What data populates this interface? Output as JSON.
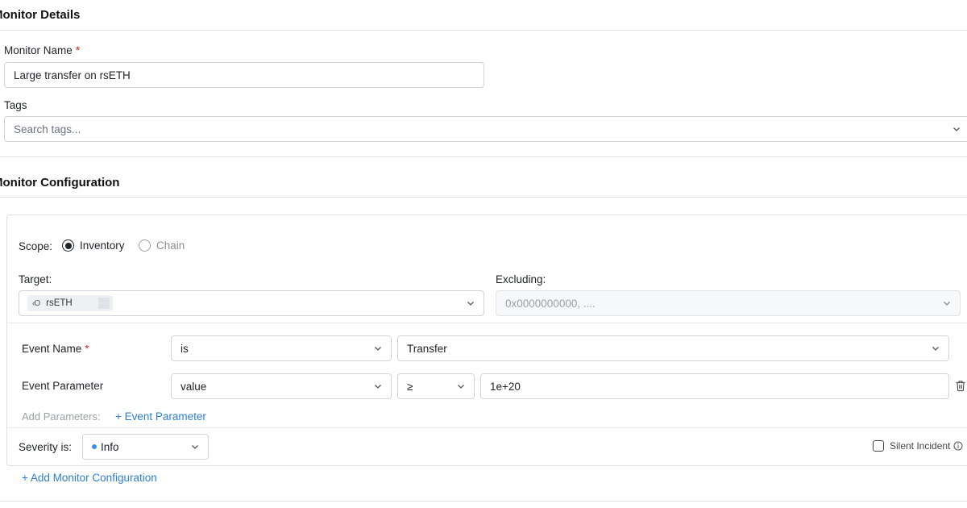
{
  "monitor_details": {
    "title": "Monitor Details",
    "name_label": "Monitor Name",
    "required_mark": "*",
    "name_value": "Large transfer on rsETH",
    "tags_label": "Tags",
    "tags_placeholder": "Search tags..."
  },
  "monitor_configuration": {
    "title": "Monitor Configuration",
    "scope_label": "Scope:",
    "scope_options": [
      "Inventory",
      "Chain"
    ],
    "scope_selected": "Inventory",
    "target_label": "Target:",
    "target_chip": {
      "icon": "‹O",
      "label": "rsETH"
    },
    "excluding_label": "Excluding:",
    "excluding_placeholder": "0x0000000000, ....",
    "event_name_label": "Event Name",
    "event_name_operator": "is",
    "event_name_value": "Transfer",
    "event_param_label": "Event Parameter",
    "event_param_name": "value",
    "event_param_operator": "≥",
    "event_param_value": "1e+20",
    "add_params_label": "Add Parameters:",
    "add_event_param_link": "+ Event Parameter",
    "severity_label": "Severity is:",
    "severity_value": "Info",
    "severity_color": "#3b8fe8",
    "silent_incident_label": "Silent Incident",
    "add_config_link": "+ Add Monitor Configuration"
  },
  "icons": {
    "chevron": "chevron-down-icon",
    "trash": "trash-icon",
    "info": "info-circle-icon"
  }
}
